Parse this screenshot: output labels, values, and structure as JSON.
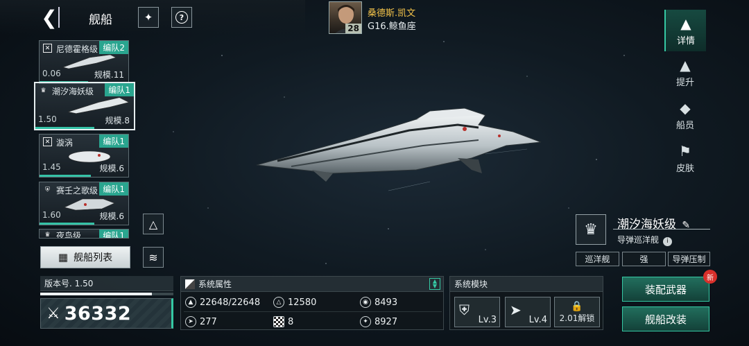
{
  "header": {
    "title": "舰船"
  },
  "captain": {
    "name": "桑德斯.凯文",
    "level": "28",
    "zone": "G16.鲸鱼座"
  },
  "ship_cards": [
    {
      "name": "尼德霍格级",
      "fleet": "编队2",
      "version": "0.06",
      "scale": "规模.11",
      "progress": 0.55,
      "class_icon": "x-square-icon"
    },
    {
      "name": "潮汐海妖级",
      "fleet": "编队1",
      "version": "1.50",
      "scale": "规模.8",
      "progress": 0.6,
      "class_icon": "crown-icon"
    },
    {
      "name": "漩涡",
      "fleet": "编队1",
      "version": "1.45",
      "scale": "规模.6",
      "progress": 0.58,
      "class_icon": "x-square-icon"
    },
    {
      "name": "赛壬之歌级",
      "fleet": "编队1",
      "version": "1.60",
      "scale": "规模.6",
      "progress": 0.62,
      "class_icon": "shield-icon"
    },
    {
      "name": "夜鸟级",
      "fleet": "编队1"
    }
  ],
  "ship_list_button": "舰船列表",
  "right_tabs": [
    {
      "label": "详情",
      "icon": "detail-icon"
    },
    {
      "label": "提升",
      "icon": "upgrade-icon"
    },
    {
      "label": "船员",
      "icon": "crew-icon"
    },
    {
      "label": "皮肤",
      "icon": "skin-icon"
    }
  ],
  "ship_info": {
    "name": "潮汐海妖级",
    "type": "导弹巡洋舰",
    "tags": [
      "巡洋舰",
      "强",
      "导弹压制"
    ]
  },
  "version_panel": {
    "label": "版本号. 1.50",
    "power": "36332"
  },
  "stats_panel": {
    "title": "系统属性",
    "stats": [
      {
        "icon": "hull-icon",
        "value": "22648/22648"
      },
      {
        "icon": "armor-icon",
        "value": "12580"
      },
      {
        "icon": "shield-icon",
        "value": "8493"
      },
      {
        "icon": "speed-icon",
        "value": "277"
      },
      {
        "icon": "checker-icon",
        "value": "8"
      },
      {
        "icon": "target-icon",
        "value": "8927"
      }
    ]
  },
  "modules_panel": {
    "title": "系统模块",
    "modules": [
      {
        "icon": "shield-module-icon",
        "level": "Lv.3"
      },
      {
        "icon": "missile-module-icon",
        "level": "Lv.4"
      },
      {
        "icon": "lock-icon",
        "unlock_text": "2.01解锁"
      }
    ]
  },
  "actions": {
    "equip": "装配武器",
    "modify": "舰船改装",
    "new_badge": "新"
  }
}
